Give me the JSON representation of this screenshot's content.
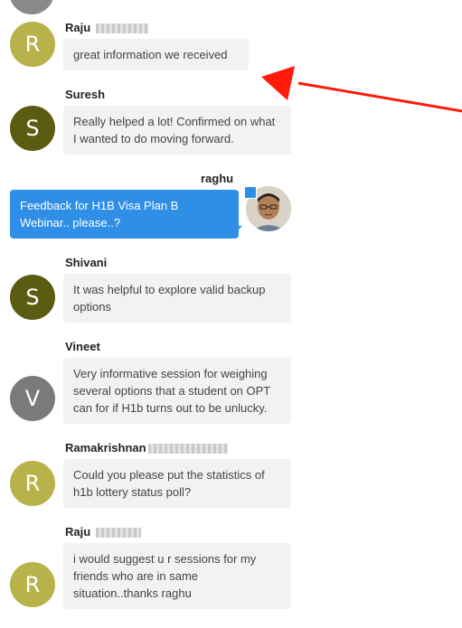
{
  "colors": {
    "avatar_olive": "#b7b34a",
    "avatar_dark_olive": "#5b5c12",
    "avatar_gray": "#7a7a7a",
    "my_bubble": "#2f8fe6",
    "other_bubble": "#f2f2f2",
    "annotation_arrow": "#ff1a0a"
  },
  "messages": [
    {
      "initial": "R",
      "name": "Raju",
      "text": "great information we received"
    },
    {
      "initial": "S",
      "name": "Suresh",
      "text": "Really helped a lot! Confirmed on what I wanted to do moving forward."
    },
    {
      "name": "raghu",
      "text": "Feedback for H1B Visa Plan B Webinar.. please..?"
    },
    {
      "initial": "S",
      "name": "Shivani",
      "text": "It was helpful to explore valid backup options"
    },
    {
      "initial": "V",
      "name": "Vineet",
      "text": "Very informative session for weighing several options that a student on OPT can for if H1b turns out to be unlucky."
    },
    {
      "initial": "R",
      "name": "Ramakrishnan",
      "text": "Could you please put the statistics of h1b lottery status poll?"
    },
    {
      "initial": "R",
      "name": "Raju",
      "text": "i would suggest u r sessions for my friends who are in same situation..thanks raghu"
    }
  ]
}
